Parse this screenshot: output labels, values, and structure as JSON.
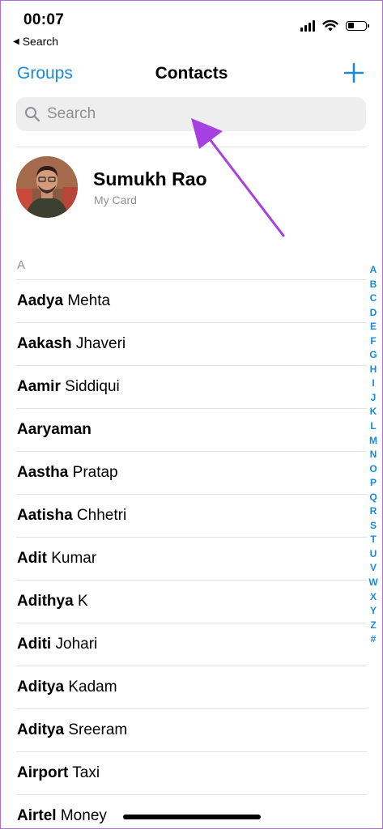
{
  "status_bar": {
    "time": "00:07",
    "back_app": "Search",
    "back_icon": "back-triangle-icon"
  },
  "nav": {
    "left_label": "Groups",
    "title": "Contacts",
    "add_icon": "plus-icon"
  },
  "search": {
    "placeholder": "Search",
    "icon": "magnifier-icon"
  },
  "my_card": {
    "name": "Sumukh Rao",
    "subtitle": "My Card"
  },
  "section": {
    "header": "A"
  },
  "contacts": [
    {
      "first": "Aadya",
      "last": "Mehta"
    },
    {
      "first": "Aakash",
      "last": "Jhaveri"
    },
    {
      "first": "Aamir",
      "last": "Siddiqui"
    },
    {
      "first": "Aaryaman",
      "last": ""
    },
    {
      "first": "Aastha",
      "last": "Pratap"
    },
    {
      "first": "Aatisha",
      "last": "Chhetri"
    },
    {
      "first": "Adit",
      "last": "Kumar"
    },
    {
      "first": "Adithya",
      "last": "K"
    },
    {
      "first": "Aditi",
      "last": "Johari"
    },
    {
      "first": "Aditya",
      "last": "Kadam"
    },
    {
      "first": "Aditya",
      "last": "Sreeram"
    },
    {
      "first": "Airport",
      "last": "Taxi"
    },
    {
      "first": "Airtel",
      "last": "Money"
    }
  ],
  "index_letters": [
    "A",
    "B",
    "C",
    "D",
    "E",
    "F",
    "G",
    "H",
    "I",
    "J",
    "K",
    "L",
    "M",
    "N",
    "O",
    "P",
    "Q",
    "R",
    "S",
    "T",
    "U",
    "V",
    "W",
    "X",
    "Y",
    "Z",
    "#"
  ],
  "colors": {
    "accent": "#1a8ad6",
    "annotation": "#a640e0",
    "secondary_text": "#8e8e93"
  }
}
